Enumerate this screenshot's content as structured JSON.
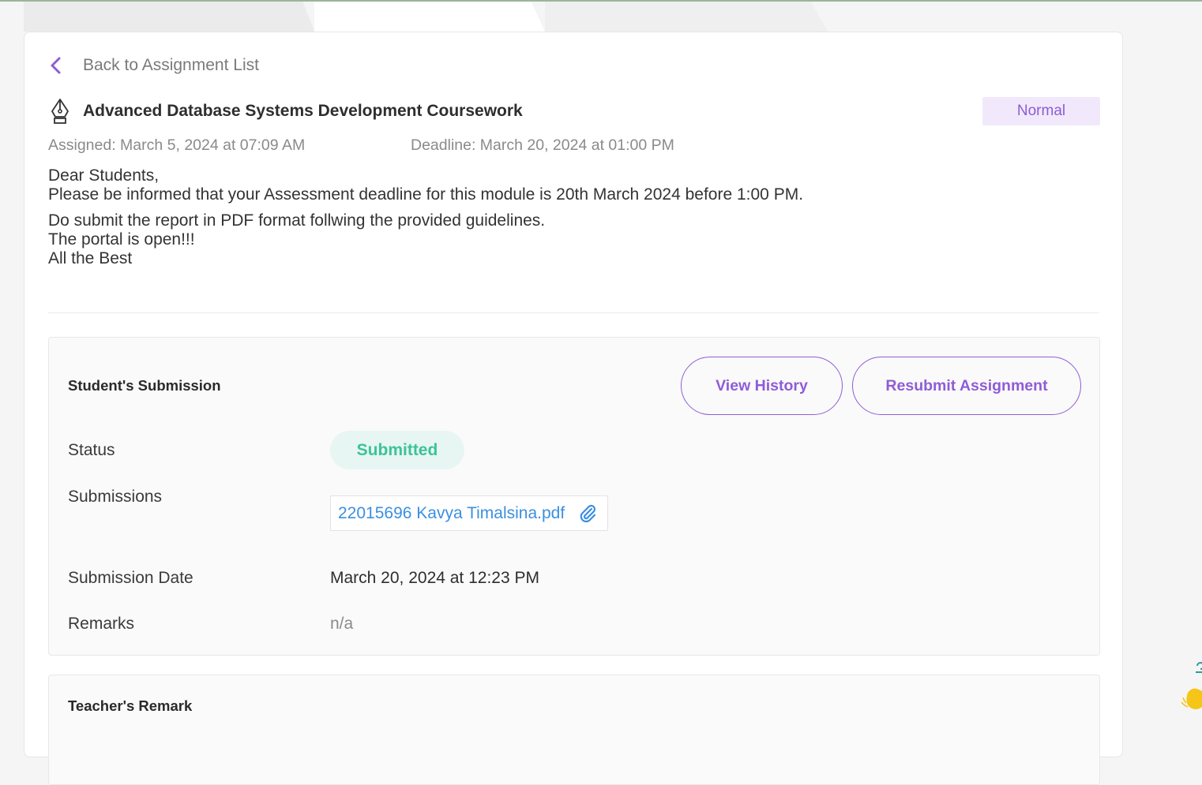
{
  "back_link": {
    "label": "Back to Assignment List"
  },
  "assignment": {
    "title": "Advanced Database Systems Development Coursework",
    "priority_badge": "Normal",
    "assigned": "Assigned: March 5, 2024 at 07:09 AM",
    "deadline": "Deadline: March 20, 2024 at 01:00 PM",
    "message": [
      "Dear Students,",
      "Please be informed that your Assessment deadline for this module is 20th March 2024 before 1:00 PM.",
      "Do submit the report in PDF format follwing the provided guidelines.",
      "The portal is open!!!",
      "All the Best"
    ]
  },
  "submission": {
    "heading": "Student's Submission",
    "view_history_label": "View History",
    "resubmit_label": "Resubmit Assignment",
    "status_label": "Status",
    "status_value": "Submitted",
    "submissions_label": "Submissions",
    "file_name": "22015696 Kavya Timalsina.pdf",
    "submission_date_label": "Submission Date",
    "submission_date_value": "March 20, 2024 at 12:23 PM",
    "remarks_label": "Remarks",
    "remarks_value": "n/a"
  },
  "teacher_remark": {
    "heading": "Teacher's Remark"
  },
  "colors": {
    "accent": "#8f5cd8",
    "status_green": "#3cc29a",
    "link_blue": "#3b8fe0",
    "badge_bg": "#f1e9fb"
  },
  "icons": [
    "chevron-left-icon",
    "pen-nib-icon",
    "paperclip-icon",
    "waving-hand-icon"
  ]
}
